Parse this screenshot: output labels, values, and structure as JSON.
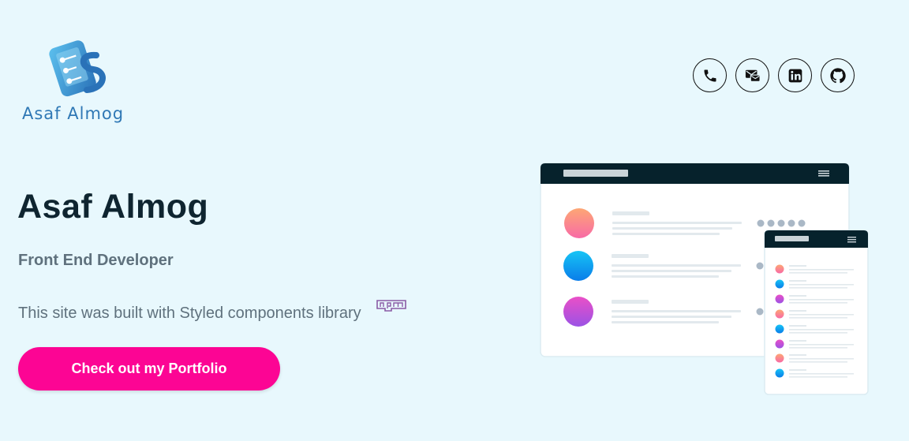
{
  "logo": {
    "text": "Asaf Almog"
  },
  "social": [
    {
      "icon": "phone-icon",
      "label": "Phone"
    },
    {
      "icon": "email-icon",
      "label": "Email"
    },
    {
      "icon": "linkedin-icon",
      "label": "LinkedIn"
    },
    {
      "icon": "github-icon",
      "label": "GitHub"
    }
  ],
  "hero": {
    "title": "Asaf Almog",
    "role": "Front End Developer",
    "description": "This site was built with Styled components library",
    "cta_label": "Check out my Portfolio"
  },
  "colors": {
    "background": "#e8f8fd",
    "cta": "#fc0594",
    "title": "#0f2530",
    "muted_text": "#5f717d",
    "logo_blue": "#2f78b5",
    "illustration_header": "#06222c"
  }
}
